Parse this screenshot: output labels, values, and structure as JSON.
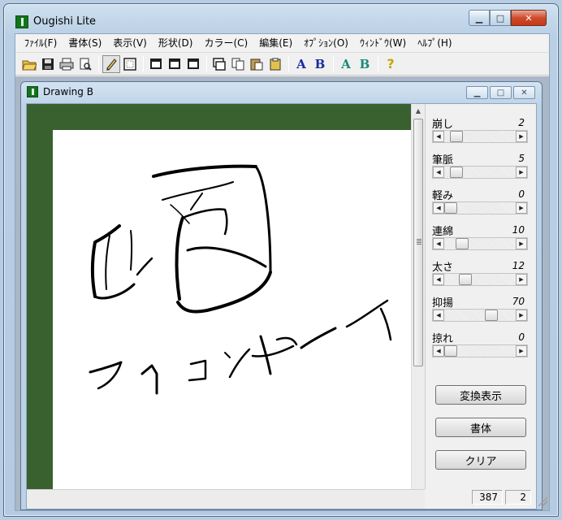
{
  "window": {
    "title": "Ougishi Lite"
  },
  "menu": [
    "ﾌｧｲﾙ(F)",
    "書体(S)",
    "表示(V)",
    "形状(D)",
    "カラー(C)",
    "編集(E)",
    "ｵﾌﾟｼｮﾝ(O)",
    "ｳｨﾝﾄﾞｳ(W)",
    "ﾍﾙﾌﾟ(H)"
  ],
  "toolbar": {
    "icons": [
      "open-folder-icon",
      "save-icon",
      "print-icon",
      "print-preview-icon",
      "pen-icon",
      "grid-icon",
      "frame-icon",
      "frame-icon",
      "frame-icon",
      "window-icon",
      "copy-icon",
      "paste-icon",
      "clipboard-icon",
      "letter-a-icon",
      "letter-b-icon",
      "letter-a-icon",
      "letter-b-icon",
      "help-icon"
    ],
    "letter_a": "A",
    "letter_b": "B",
    "help": "?",
    "letter_colors": {
      "blue": "#1a2a9c",
      "teal": "#1a8a7a"
    }
  },
  "document": {
    "title": "Drawing B"
  },
  "canvas": {
    "background": "#39612f",
    "paper": "#ffffff"
  },
  "params": [
    {
      "label": "崩し",
      "value": "2",
      "position": 0.1
    },
    {
      "label": "筆脈",
      "value": "5",
      "position": 0.1
    },
    {
      "label": "軽み",
      "value": "0",
      "position": 0.0
    },
    {
      "label": "連綿",
      "value": "10",
      "position": 0.2
    },
    {
      "label": "太さ",
      "value": "12",
      "position": 0.25
    },
    {
      "label": "抑揚",
      "value": "70",
      "position": 0.7
    },
    {
      "label": "掠れ",
      "value": "0",
      "position": 0.0
    }
  ],
  "buttons": {
    "convert": "変換表示",
    "font": "書体",
    "clear": "クリア"
  },
  "status": {
    "first": "387",
    "second": "2"
  }
}
